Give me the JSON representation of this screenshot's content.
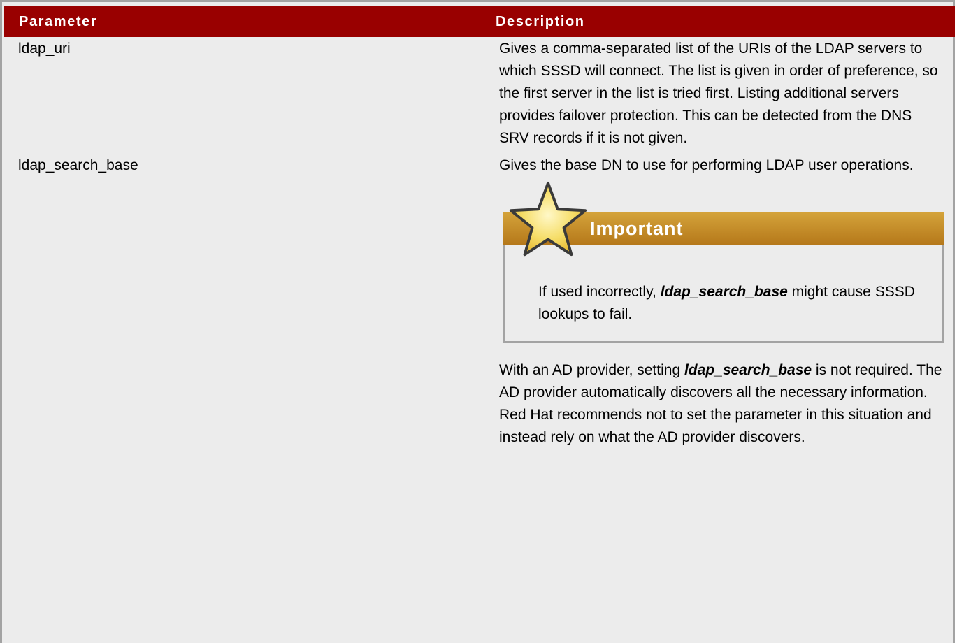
{
  "table": {
    "headers": [
      "Parameter",
      "Description"
    ],
    "rows": [
      {
        "parameter": "ldap_uri",
        "description": "Gives a comma-separated list of the URIs of the LDAP servers to which SSSD will connect. The list is given in order of preference, so the first server in the list is tried first. Listing additional servers provides failover protection. This can be detected from the DNS SRV records if it is not given."
      },
      {
        "parameter": "ldap_search_base",
        "description": "Gives the base DN to use for performing LDAP user operations.",
        "admonition": {
          "title": "Important",
          "icon": "star-icon",
          "text_before": "If used incorrectly, ",
          "emphasis": "ldap_search_base",
          "text_after": " might cause SSSD lookups to fail."
        },
        "note": {
          "text_before": "With an AD provider, setting ",
          "emphasis": "ldap_search_base",
          "text_after": " is not required. The AD provider automatically discovers all the necessary information. Red Hat recommends not to set the parameter in this situation and instead rely on what the AD provider discovers."
        }
      }
    ]
  },
  "colors": {
    "header_bg": "#990000",
    "header_text": "#ffffff",
    "body_bg": "#ececec",
    "admonition_bar": "#c58c28",
    "border": "#a3a3a3"
  }
}
